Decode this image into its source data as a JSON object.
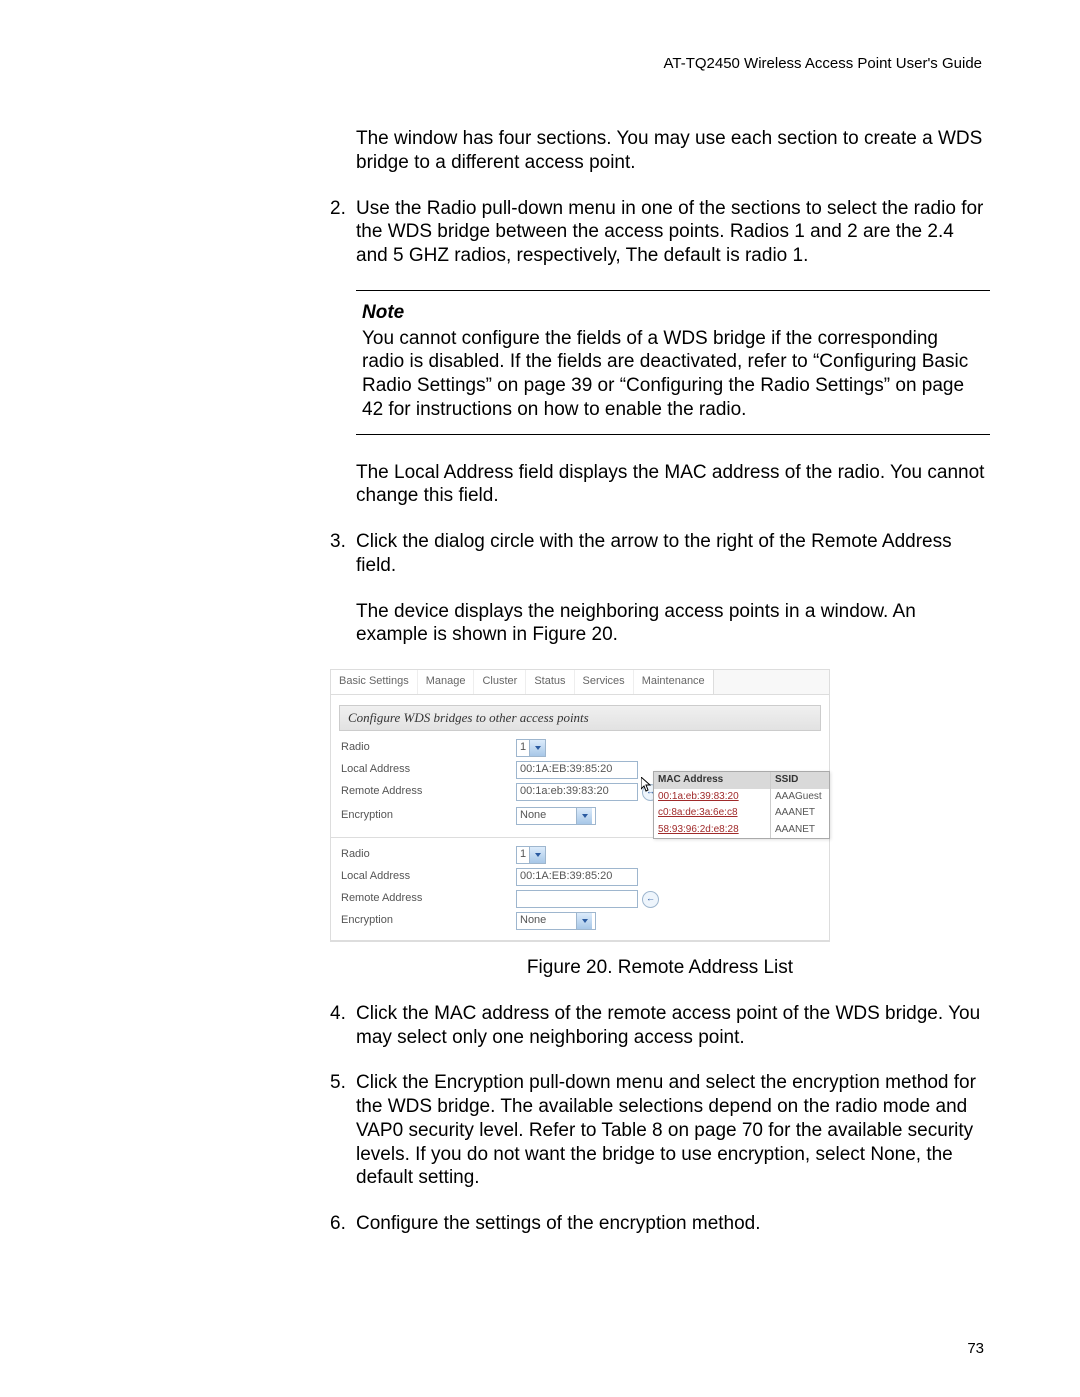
{
  "header": "AT-TQ2450 Wireless Access Point User's Guide",
  "page_number": "73",
  "intro_para": "The window has four sections. You may use each section to create a WDS bridge to a different access point.",
  "step2_num": "2.",
  "step2": "Use the Radio pull-down menu in one of the sections to select the radio for the WDS bridge between the access points. Radios 1 and 2 are the 2.4 and 5 GHZ radios, respectively, The default is radio 1.",
  "note_label": "Note",
  "note_body": "You cannot configure the fields of a WDS bridge if the corresponding radio is disabled. If the fields are deactivated, refer to “Configuring Basic Radio Settings” on page 39 or “Configuring the Radio Settings” on page 42 for instructions on how to enable the radio.",
  "local_addr_para": "The Local Address field displays the MAC address of the radio. You cannot change this field.",
  "step3_num": "3.",
  "step3": "Click the dialog circle with the arrow to the right of the Remote Address field.",
  "step3_tail": "The device displays the neighboring access points in a window. An example is shown in Figure 20.",
  "figure_caption": "Figure 20. Remote Address List",
  "step4_num": "4.",
  "step4": "Click the MAC address of the remote access point of the WDS bridge. You may select only one neighboring access point.",
  "step5_num": "5.",
  "step5": "Click the Encryption pull-down menu and select the encryption method for the WDS bridge. The available selections depend on the radio mode and VAP0 security level. Refer to Table 8 on page 70 for the available security levels. If you do not want the bridge to use encryption, select None, the default setting.",
  "step6_num": "6.",
  "step6": "Configure the settings of the encryption method.",
  "ui": {
    "tabs": [
      "Basic Settings",
      "Manage",
      "Cluster",
      "Status",
      "Services",
      "Maintenance"
    ],
    "title": "Configure WDS bridges to other access points",
    "labels": {
      "radio": "Radio",
      "local": "Local Address",
      "remote": "Remote Address",
      "encryption": "Encryption"
    },
    "values": {
      "radio": "1",
      "local1": "00:1A:EB:39:85:20",
      "remote1": "00:1a:eb:39:83:20",
      "enc1": "None",
      "local2": "00:1A:EB:39:85:20",
      "remote2": "",
      "enc2": "None"
    },
    "ap_table": {
      "headers": [
        "MAC Address",
        "SSID"
      ],
      "rows": [
        {
          "mac": "00:1a:eb:39:83:20",
          "ssid": "AAAGuest"
        },
        {
          "mac": "c0:8a:de:3a:6e:c8",
          "ssid": "AAANET"
        },
        {
          "mac": "58:93:96:2d:e8:28",
          "ssid": "AAANET"
        }
      ]
    }
  }
}
